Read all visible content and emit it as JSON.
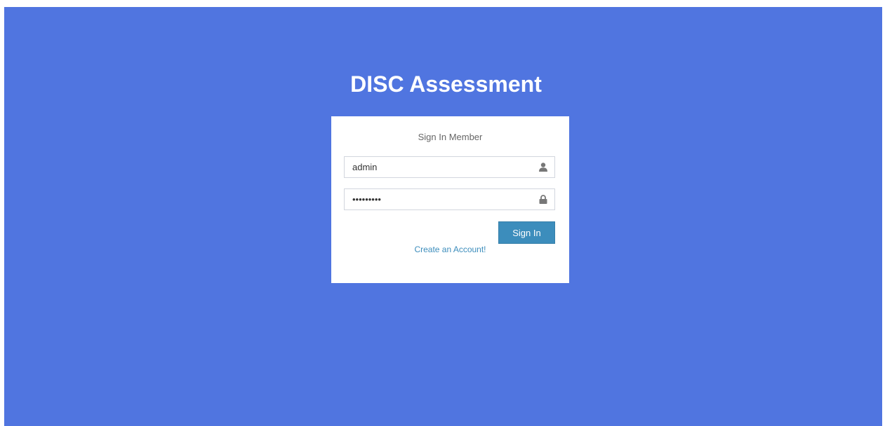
{
  "app": {
    "title": "DISC Assessment"
  },
  "login": {
    "heading": "Sign In Member",
    "username": {
      "value": "admin",
      "icon": "user-icon"
    },
    "password": {
      "value": "123456789",
      "icon": "lock-icon"
    },
    "submit_label": "Sign In",
    "register_link": "Create an Account!"
  },
  "colors": {
    "background": "#5075e0",
    "card": "#ffffff",
    "button": "#3c8dbc",
    "link": "#3c8dbc",
    "icon": "#777777"
  }
}
